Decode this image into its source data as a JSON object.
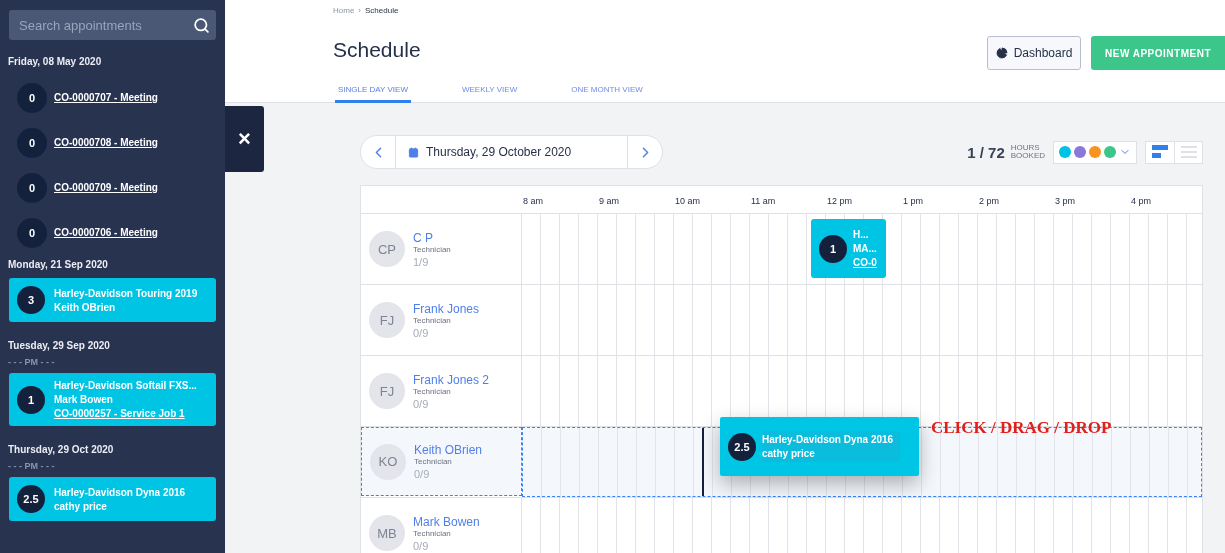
{
  "sidebar": {
    "search_placeholder": "Search appointments",
    "groups": [
      {
        "date": "Friday, 08 May 2020",
        "items": [
          {
            "kind": "link",
            "count": "0",
            "label": "CO-0000707 - Meeting"
          },
          {
            "kind": "link",
            "count": "0",
            "label": "CO-0000708 - Meeting"
          },
          {
            "kind": "link",
            "count": "0",
            "label": "CO-0000709 - Meeting"
          },
          {
            "kind": "link",
            "count": "0",
            "label": "CO-0000706 - Meeting"
          }
        ]
      },
      {
        "date": "Monday, 21 Sep 2020",
        "items": [
          {
            "kind": "card",
            "count": "3",
            "lines": [
              "Harley-Davidson Touring 2019",
              "Keith OBrien"
            ]
          }
        ]
      },
      {
        "date": "Tuesday, 29 Sep 2020",
        "period": "- - - PM - - -",
        "items": [
          {
            "kind": "card",
            "count": "1",
            "lines": [
              "Harley-Davidson Softail FXS...",
              "Mark Bowen"
            ],
            "link": "CO-0000257 - Service Job 1"
          }
        ]
      },
      {
        "date": "Thursday, 29 Oct 2020",
        "period": "- - - PM - - -",
        "items": [
          {
            "kind": "card",
            "count": "2.5",
            "lines": [
              "Harley-Davidson Dyna 2016",
              "cathy price"
            ]
          }
        ]
      }
    ]
  },
  "close_symbol": "×",
  "breadcrumb": {
    "items": [
      "Home",
      "Schedule"
    ],
    "separator": "›"
  },
  "title": "Schedule",
  "buttons": {
    "dashboard": "Dashboard",
    "new_appointment": "NEW APPOINTMENT"
  },
  "tabs": [
    {
      "label": "SINGLE DAY VIEW",
      "selected": true
    },
    {
      "label": "WEEKLY VIEW",
      "selected": false
    },
    {
      "label": "ONE MONTH VIEW",
      "selected": false
    }
  ],
  "date_nav": {
    "date": "Thursday, 29 October 2020"
  },
  "booked": {
    "value": "1 / 72",
    "unit": [
      "HOURS",
      "BOOKED"
    ]
  },
  "color_filter": [
    {
      "color": "#00c3e3"
    },
    {
      "color": "#8b78d6"
    },
    {
      "color": "#f7931e"
    },
    {
      "color": "#3cc68a"
    }
  ],
  "view_toggle": [
    {
      "kind": "timeline",
      "selected": true
    },
    {
      "kind": "list",
      "selected": false
    }
  ],
  "hours": [
    "8 am",
    "9 am",
    "10 am",
    "11 am",
    "12 pm",
    "1 pm",
    "2 pm",
    "3 pm",
    "4 pm"
  ],
  "technicians": [
    {
      "initials": "CP",
      "name": "C P",
      "role": "Technician",
      "hours": "1/9",
      "highlighted": false,
      "appointments": [
        {
          "count": "1",
          "lines": [
            "H...",
            "MA..."
          ],
          "link": "CO-0"
        }
      ]
    },
    {
      "initials": "FJ",
      "name": "Frank Jones",
      "role": "Technician",
      "hours": "0/9",
      "highlighted": false
    },
    {
      "initials": "FJ",
      "name": "Frank Jones 2",
      "role": "Technician",
      "hours": "0/9",
      "highlighted": false
    },
    {
      "initials": "KO",
      "name": "Keith OBrien",
      "role": "Technician",
      "hours": "0/9",
      "highlighted": true
    },
    {
      "initials": "MB",
      "name": "Mark Bowen",
      "role": "Technician",
      "hours": "0/9",
      "highlighted": false
    }
  ],
  "drag_card": {
    "count": "2.5",
    "lines": [
      "Harley-Davidson Dyna 2016",
      "cathy price"
    ]
  },
  "annotation": "CLICK / DRAG / DROP"
}
